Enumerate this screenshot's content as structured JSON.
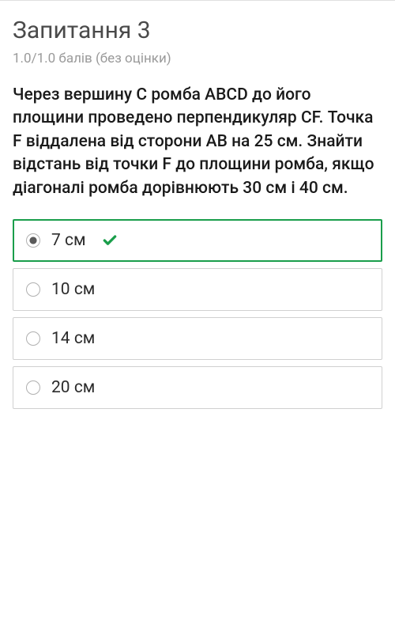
{
  "question": {
    "title": "Запитання 3",
    "points": "1.0/1.0 балів (без оцінки)",
    "text": "Через вершину С ромба АВСD до його площини проведено перпендикуляр СF. Точка F віддалена від сторони АВ на 25 см. Знайти відстань від точки F до площини ромба, якщо діагоналі ромба дорівнюють 30 см і 40 см."
  },
  "options": [
    {
      "label": "7 см",
      "selected": true,
      "correct": true
    },
    {
      "label": "10 см",
      "selected": false,
      "correct": false
    },
    {
      "label": "14 см",
      "selected": false,
      "correct": false
    },
    {
      "label": "20 см",
      "selected": false,
      "correct": false
    }
  ],
  "colors": {
    "correct": "#1a9e4b"
  }
}
